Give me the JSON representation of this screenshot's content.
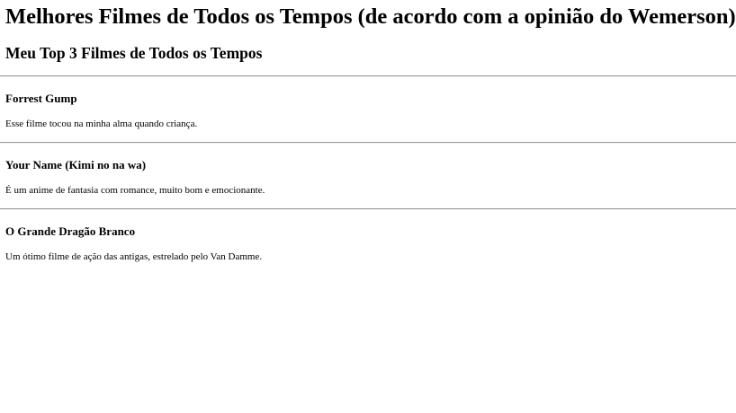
{
  "page": {
    "title": "Melhores Filmes de Todos os Tempos (de acordo com a opinião do Wemerson)",
    "subtitle": "Meu Top 3 Filmes de Todos os Tempos"
  },
  "movies": [
    {
      "title": "Forrest Gump",
      "description": "Esse filme tocou na minha alma quando criança."
    },
    {
      "title": "Your Name (Kimi no na wa)",
      "description": "É um anime de fantasia com romance, muito bom e emocionante."
    },
    {
      "title": "O Grande Dragão Branco",
      "description": "Um ótimo filme de ação das antigas, estrelado pelo Van Damme."
    }
  ]
}
